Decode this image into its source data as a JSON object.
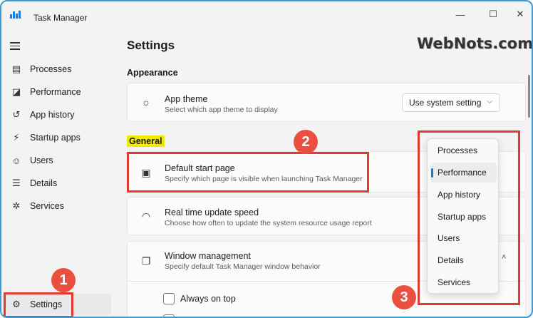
{
  "window": {
    "title": "Task Manager",
    "minimize_glyph": "—",
    "maximize_glyph": "☐",
    "close_glyph": "✕"
  },
  "sidebar": {
    "menu_icon": "hamburger-icon",
    "items": [
      {
        "label": "Processes",
        "icon": "processes-icon",
        "glyph": "▤"
      },
      {
        "label": "Performance",
        "icon": "performance-icon",
        "glyph": "◪"
      },
      {
        "label": "App history",
        "icon": "history-icon",
        "glyph": "↺"
      },
      {
        "label": "Startup apps",
        "icon": "startup-icon",
        "glyph": "⚡"
      },
      {
        "label": "Users",
        "icon": "users-icon",
        "glyph": "☺"
      },
      {
        "label": "Details",
        "icon": "details-icon",
        "glyph": "☰"
      },
      {
        "label": "Services",
        "icon": "services-icon",
        "glyph": "✲"
      }
    ],
    "settings": {
      "label": "Settings",
      "icon": "gear-icon",
      "glyph": "⚙"
    }
  },
  "main": {
    "title": "Settings",
    "appearance": {
      "heading": "Appearance",
      "app_theme": {
        "title": "App theme",
        "subtitle": "Select which app theme to display",
        "icon": "palette-icon",
        "glyph": "☼",
        "dropdown_value": "Use system setting",
        "chevron": "⌵"
      }
    },
    "general": {
      "heading": "General",
      "default_start_page": {
        "title": "Default start page",
        "subtitle": "Specify which page is visible when launching Task Manager",
        "icon": "start-page-icon",
        "glyph": "▣"
      },
      "update_speed": {
        "title": "Real time update speed",
        "subtitle": "Choose how often to update the system resource usage report",
        "icon": "speedometer-icon",
        "glyph": "◠"
      },
      "window_management": {
        "title": "Window management",
        "subtitle": "Specify default Task Manager window behavior",
        "icon": "windows-icon",
        "glyph": "❐",
        "chevron": "˄"
      },
      "always_on_top": {
        "label": "Always on top",
        "checked": false
      }
    }
  },
  "start_page_menu": {
    "selected": "Performance",
    "options": [
      "Processes",
      "Performance",
      "App history",
      "Startup apps",
      "Users",
      "Details",
      "Services"
    ]
  },
  "annotations": {
    "badge_1": "1",
    "badge_2": "2",
    "badge_3": "3",
    "highlight_color": "#e23a2c"
  },
  "watermark": "WebNots.com",
  "colors": {
    "accent": "#1a7fbf",
    "frame_border": "#3a9bd9",
    "general_highlight": "#f2ea00",
    "badge_fill": "#e9503f"
  }
}
